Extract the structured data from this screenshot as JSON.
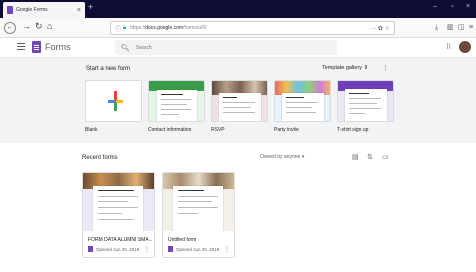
{
  "browser": {
    "tab_title": "Google Forms",
    "tab_close": "×",
    "new_tab": "+",
    "url_domain": "docs.google.com",
    "url_prefix": "https://",
    "url_suffix": "/forms/u/0/",
    "url_actions": "··· ✿ ☆"
  },
  "app": {
    "title": "Forms",
    "search_placeholder": "Search"
  },
  "templates": {
    "heading": "Start a new form",
    "gallery_label": "Template gallery",
    "items": [
      {
        "label": "Blank"
      },
      {
        "label": "Contact information"
      },
      {
        "label": "RSVP"
      },
      {
        "label": "Party invite"
      },
      {
        "label": "T-shirt sign up"
      }
    ]
  },
  "recent": {
    "heading": "Recent forms",
    "owner_filter": "Owned by anyone ▾",
    "items": [
      {
        "title": "FORM DATA ALUMNI SMA ...",
        "date": "Opened Jun 25, 2019"
      },
      {
        "title": "Untitled form",
        "date": "Opened Jun 25, 2019"
      }
    ]
  },
  "colors": {
    "brand": "#7248b9",
    "tab_bar": "#0c0c34",
    "template_bg": "#f1f3f4"
  }
}
